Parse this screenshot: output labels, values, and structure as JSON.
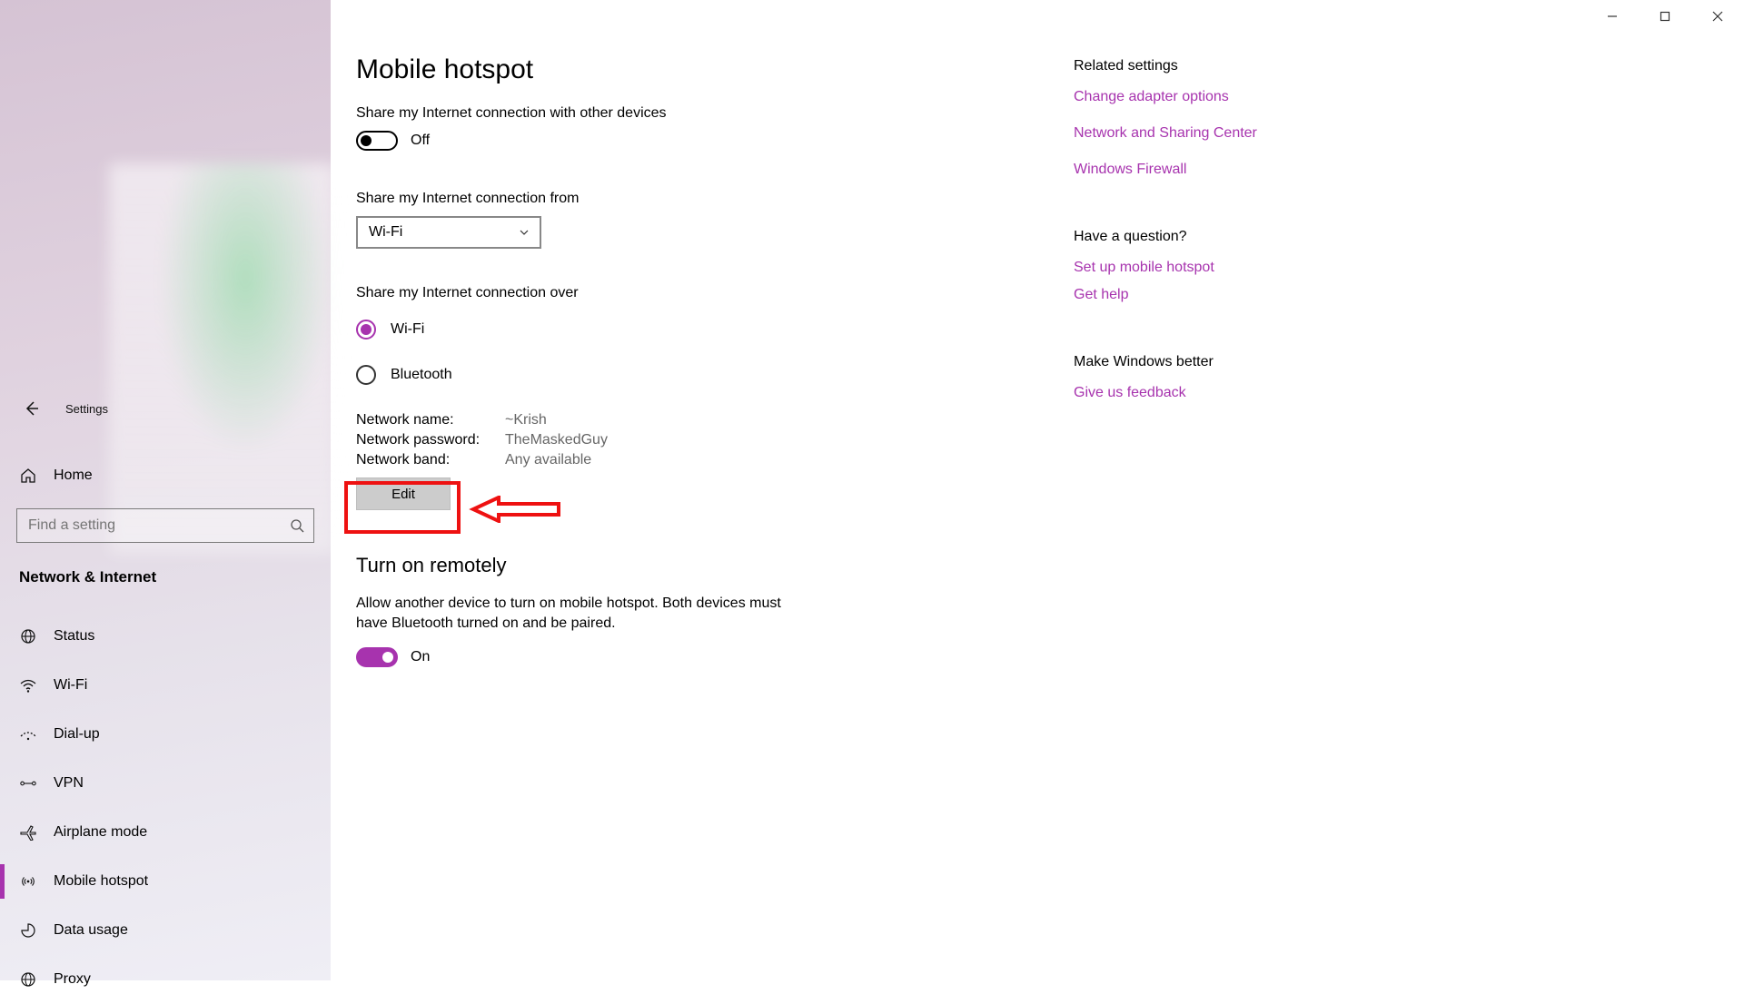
{
  "titlebar": {
    "title": "Settings"
  },
  "sidebar": {
    "home_label": "Home",
    "search_placeholder": "Find a setting",
    "section_title": "Network & Internet",
    "items": [
      {
        "label": "Status",
        "icon": "globe-icon"
      },
      {
        "label": "Wi-Fi",
        "icon": "wifi-icon"
      },
      {
        "label": "Dial-up",
        "icon": "dialup-icon"
      },
      {
        "label": "VPN",
        "icon": "vpn-icon"
      },
      {
        "label": "Airplane mode",
        "icon": "airplane-icon"
      },
      {
        "label": "Mobile hotspot",
        "icon": "hotspot-icon"
      },
      {
        "label": "Data usage",
        "icon": "data-usage-icon"
      },
      {
        "label": "Proxy",
        "icon": "proxy-icon"
      }
    ],
    "active_index": 5
  },
  "page": {
    "title": "Mobile hotspot",
    "share_toggle_title": "Share my Internet connection with other devices",
    "share_toggle_state": "Off",
    "share_from_title": "Share my Internet connection from",
    "share_from_value": "Wi-Fi",
    "share_over_title": "Share my Internet connection over",
    "share_over_options": [
      "Wi-Fi",
      "Bluetooth"
    ],
    "share_over_selected": 0,
    "kv": {
      "name_label": "Network name:",
      "name_value": "~Krish",
      "pass_label": "Network password:",
      "pass_value": "TheMaskedGuy",
      "band_label": "Network band:",
      "band_value": "Any available"
    },
    "edit_label": "Edit",
    "remote_title": "Turn on remotely",
    "remote_desc": "Allow another device to turn on mobile hotspot. Both devices must have Bluetooth turned on and be paired.",
    "remote_toggle_state": "On"
  },
  "rail": {
    "related_title": "Related settings",
    "related_links": [
      "Change adapter options",
      "Network and Sharing Center",
      "Windows Firewall"
    ],
    "question_title": "Have a question?",
    "question_links": [
      "Set up mobile hotspot",
      "Get help"
    ],
    "better_title": "Make Windows better",
    "better_links": [
      "Give us feedback"
    ]
  },
  "colors": {
    "accent": "#a733ae",
    "link": "#a733ae"
  }
}
